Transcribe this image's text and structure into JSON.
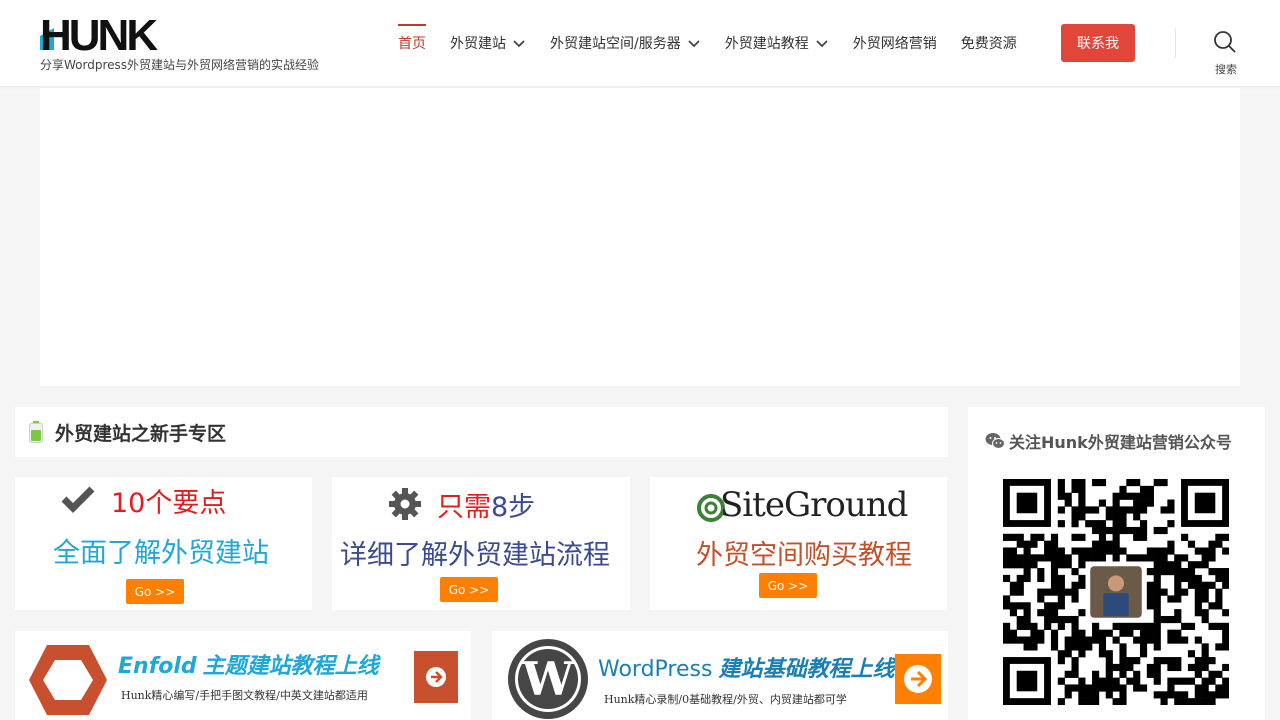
{
  "header": {
    "logo_text": "HUNK",
    "tagline": "分享Wordpress外贸建站与外贸网络营销的实战经验",
    "nav": [
      {
        "label": "首页",
        "dropdown": false,
        "active": true
      },
      {
        "label": "外贸建站",
        "dropdown": true,
        "active": false
      },
      {
        "label": "外贸建站空间/服务器",
        "dropdown": true,
        "active": false
      },
      {
        "label": "外贸建站教程",
        "dropdown": true,
        "active": false
      },
      {
        "label": "外贸网络营销",
        "dropdown": false,
        "active": false
      },
      {
        "label": "免费资源",
        "dropdown": false,
        "active": false
      }
    ],
    "contact_label": "联系我",
    "search_label": "搜索"
  },
  "section": {
    "title": "外贸建站之新手专区"
  },
  "cards": [
    {
      "line1": "10个要点",
      "line2": "全面了解外贸建站",
      "go": "Go >>",
      "icon": "check-icon"
    },
    {
      "line1_red": "只需",
      "line1_blue": "8步",
      "line2": "详细了解外贸建站流程",
      "go": "Go >>",
      "icon": "gear-icon"
    },
    {
      "brand": "SiteGround",
      "line2": "外贸空间购买教程",
      "go": "Go >>",
      "icon": "siteground-logo-icon"
    }
  ],
  "banners": [
    {
      "title_en": "Enfold",
      "title_cn": "主题建站教程上线",
      "subtitle": "Hunk精心编写/手把手图文教程/中英文建站都适用",
      "icon": "hexagon-logo-icon"
    },
    {
      "title_en": "WordPress",
      "title_cn": "建站基础教程上线",
      "subtitle": "Hunk精心录制/0基础教程/外贸、内贸建站都可学",
      "icon": "wordpress-logo-icon"
    }
  ],
  "sidebar": {
    "title": "关注Hunk外贸建站营销公众号",
    "icon": "wechat-icon"
  },
  "colors": {
    "accent_red": "#e2463b",
    "nav_active": "#c0392b",
    "go_orange": "#ff7f00",
    "blue": "#1fa7d8"
  }
}
